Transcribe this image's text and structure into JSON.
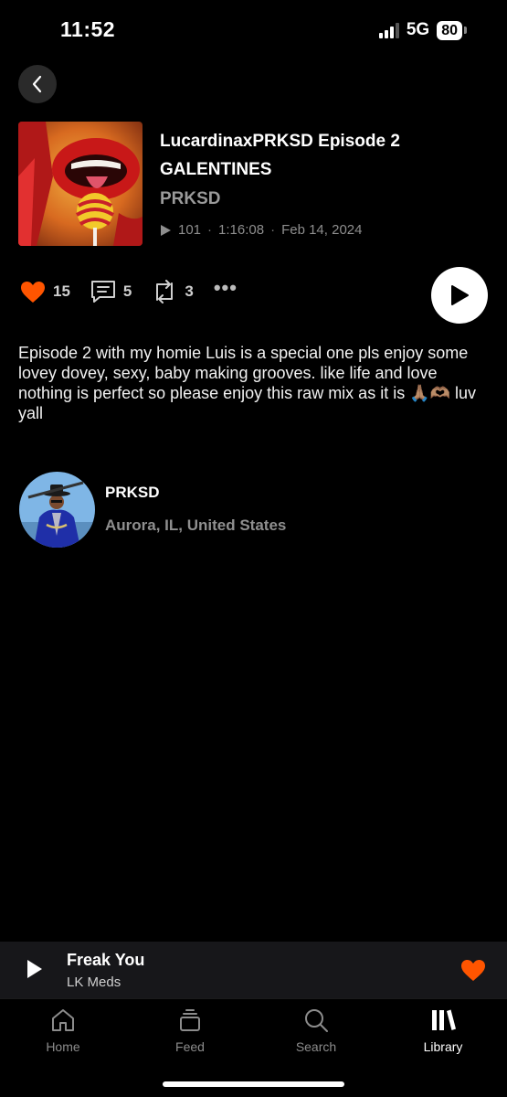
{
  "status_bar": {
    "time": "11:52",
    "network": "5G",
    "battery": "80"
  },
  "track": {
    "title": "LucardinaxPRKSD Episode 2 GALENTINES",
    "artist": "PRKSD",
    "plays": "101",
    "duration": "1:16:08",
    "date": "Feb 14, 2024",
    "meta_separator": "·"
  },
  "actions": {
    "likes": "15",
    "comments": "5",
    "reposts": "3",
    "more": "•••"
  },
  "description": "Episode 2 with my homie Luis is a special one pls enjoy some lovey dovey, sexy, baby making grooves. like life and love nothing is perfect so please enjoy this raw mix as it is 🙏🏽🫶🏽 luv yall",
  "uploader": {
    "name": "PRKSD",
    "location": "Aurora, IL, United States"
  },
  "mini_player": {
    "title": "Freak You",
    "artist": "LK Meds"
  },
  "tabs": [
    {
      "label": "Home",
      "icon": "home-icon"
    },
    {
      "label": "Feed",
      "icon": "feed-icon"
    },
    {
      "label": "Search",
      "icon": "search-icon"
    },
    {
      "label": "Library",
      "icon": "library-icon"
    }
  ],
  "colors": {
    "accent": "#ff5500",
    "background": "#000000",
    "secondary_text": "#8f8f8f"
  }
}
